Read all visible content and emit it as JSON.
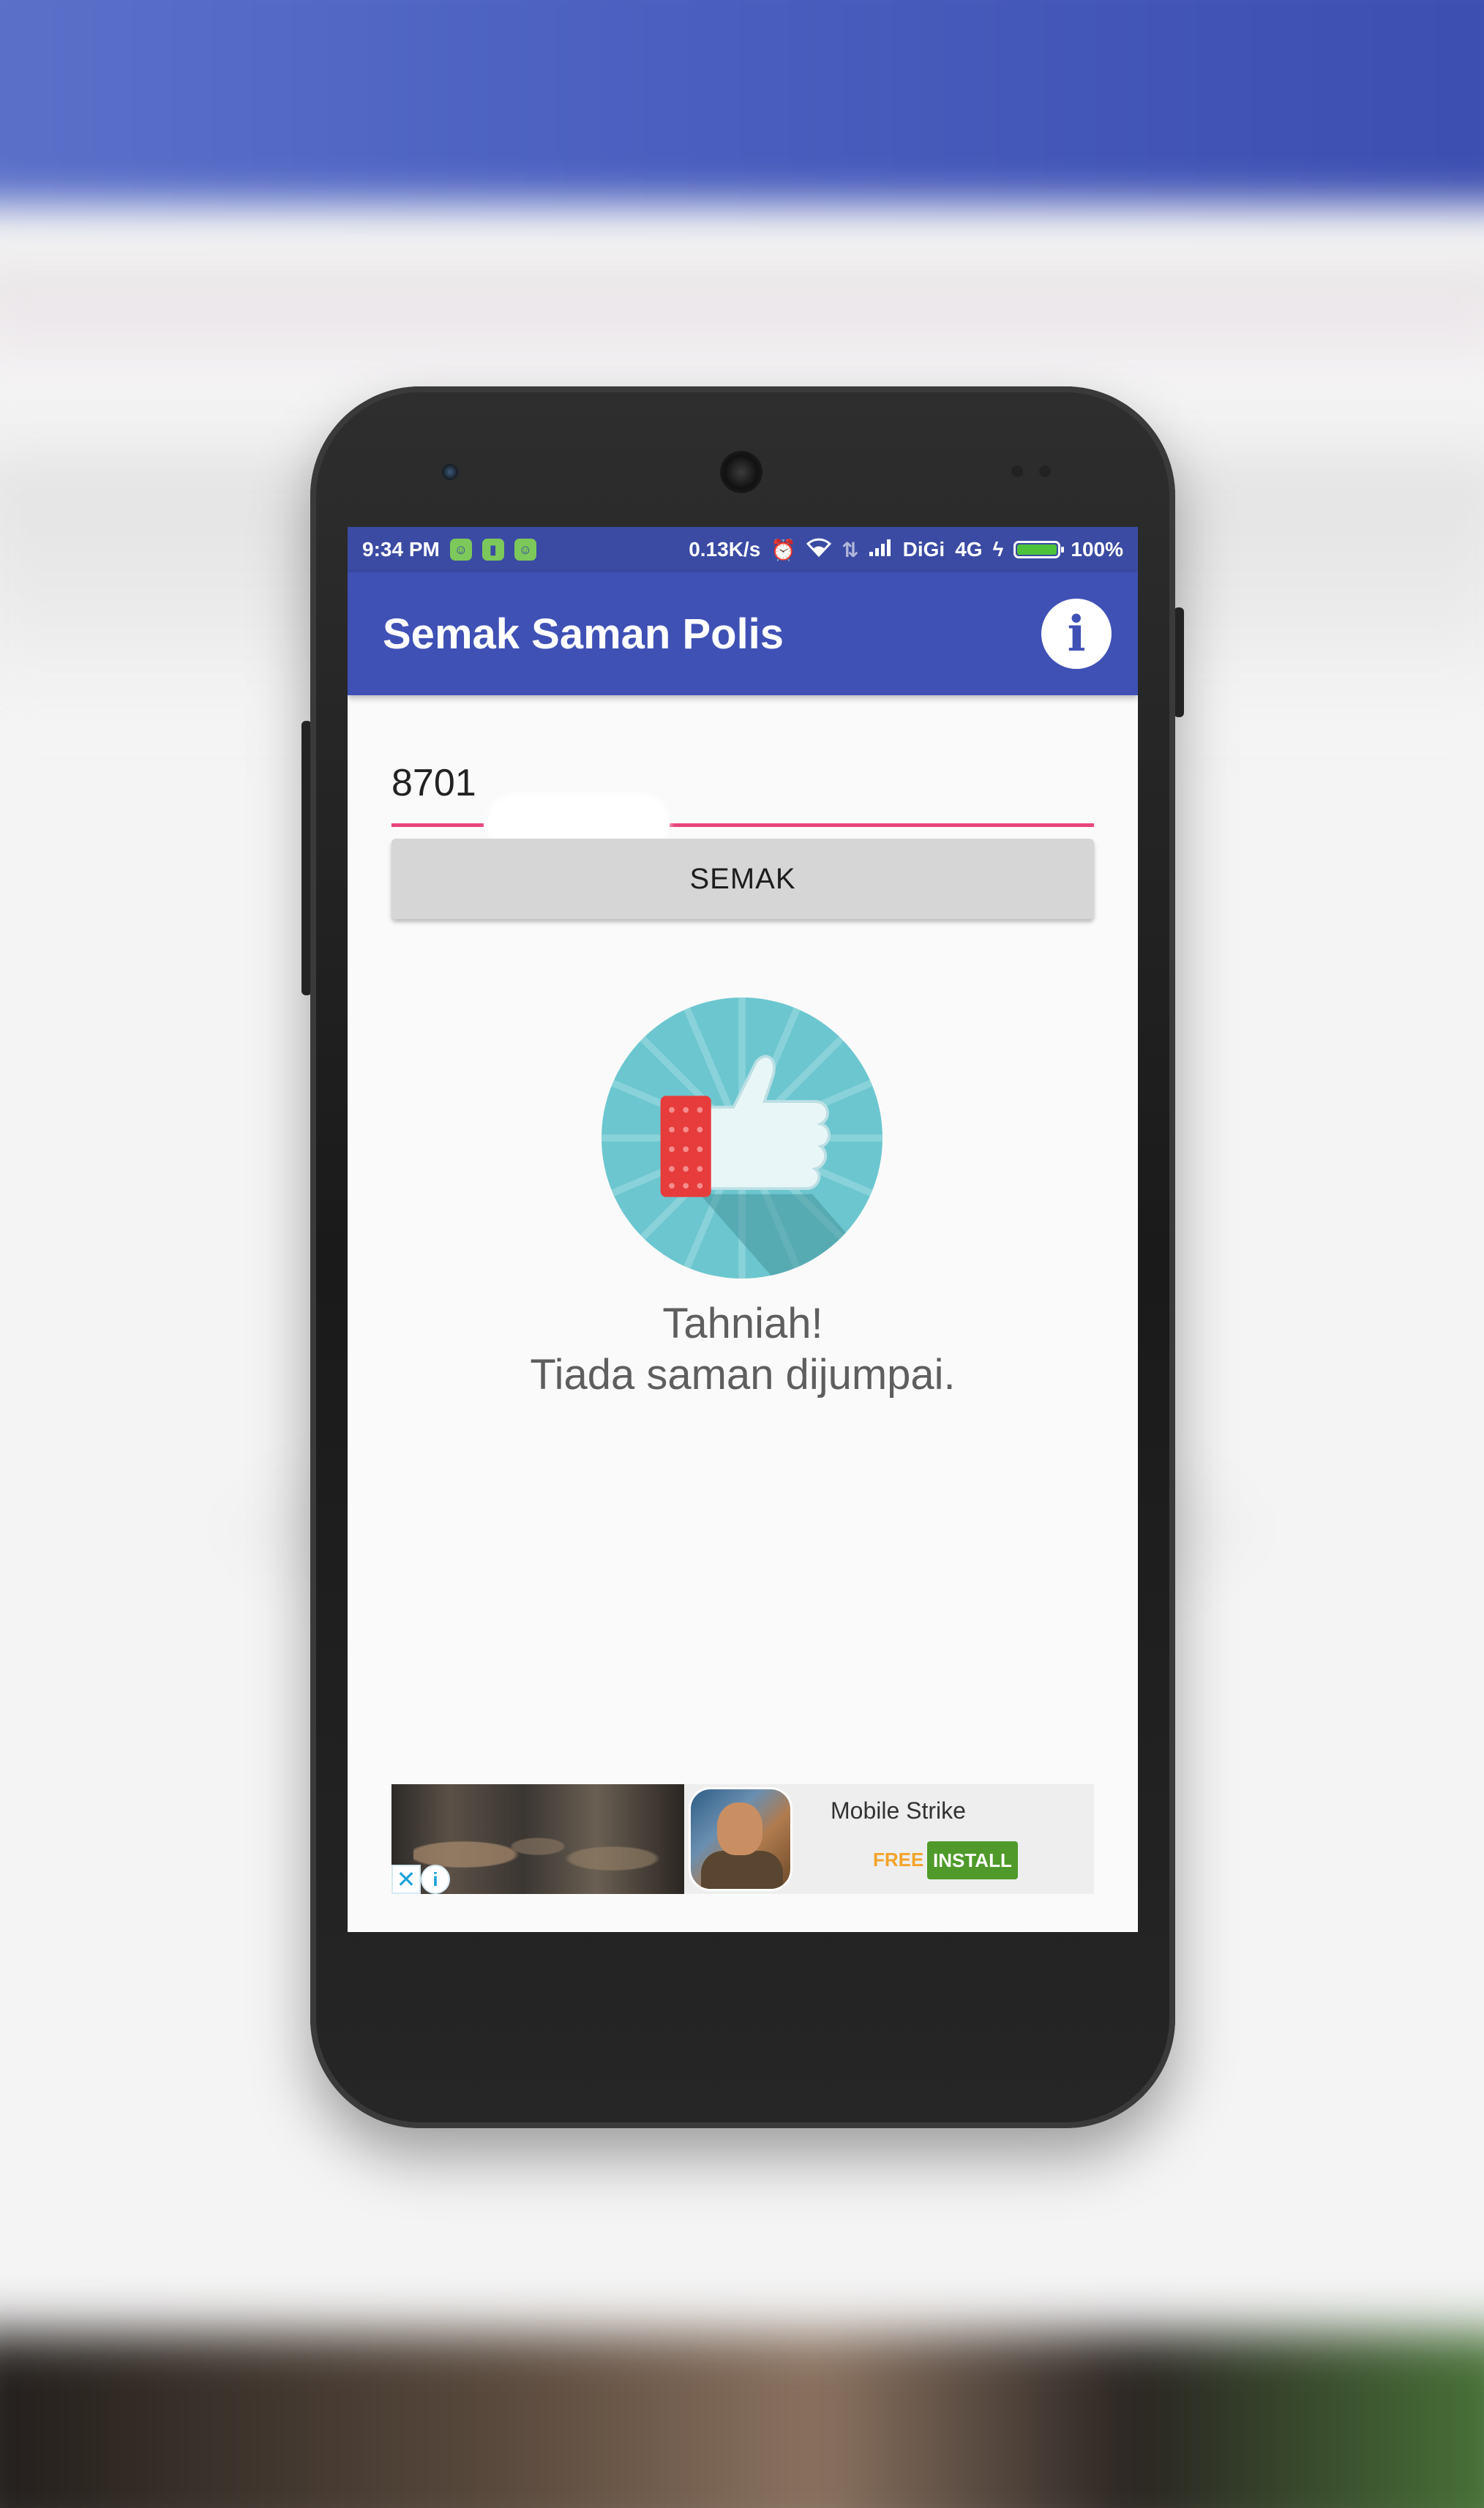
{
  "status_bar": {
    "time": "9:34 PM",
    "net_speed": "0.13K/s",
    "carrier": "DiGi",
    "network_type": "4G",
    "battery_level": "100%",
    "battery_fill_fraction": 1.0,
    "icons": [
      "app-notification-icon",
      "battery-notification-icon",
      "app-notification-icon",
      "alarm-icon",
      "wifi-icon",
      "data-arrows-icon",
      "signal-icon",
      "charging-icon",
      "battery-icon"
    ]
  },
  "app_bar": {
    "title": "Semak Saman Polis",
    "info_icon": "info-icon",
    "info_glyph": "i",
    "color": "#3f51b5",
    "status_color": "#3b4ba3"
  },
  "form": {
    "plate_input_value": "8701",
    "semak_label": "SEMAK",
    "accent_color": "#e8457d"
  },
  "result": {
    "icon": "thumbs-up-icon",
    "line1": "Tahniah!",
    "line2": "Tiada saman dijumpai."
  },
  "ad": {
    "title": "Mobile Strike",
    "price": "FREE",
    "install_label": "INSTALL",
    "close_glyph": "✕",
    "info_glyph": "i",
    "install_color": "#4f9a2a",
    "price_color": "#f2a32a"
  }
}
